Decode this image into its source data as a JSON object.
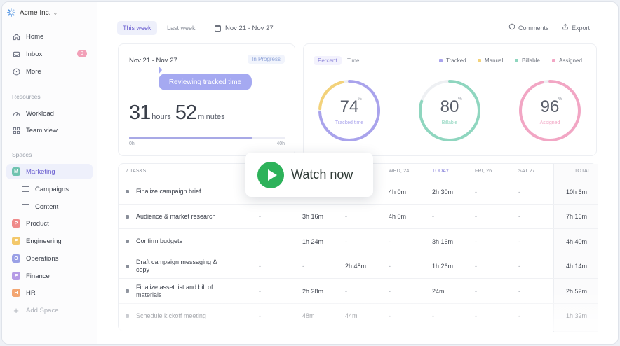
{
  "workspace": {
    "name": "Acme Inc.",
    "caret": "⌄"
  },
  "sidebar": {
    "home": "Home",
    "inbox": "Inbox",
    "inbox_badge": "9",
    "more": "More",
    "resources_title": "Resources",
    "workload": "Workload",
    "team_view": "Team view",
    "spaces_title": "Spaces",
    "spaces": [
      {
        "letter": "M",
        "label": "Marketing",
        "color": "#6fc3b0"
      },
      {
        "letter": "P",
        "label": "Product",
        "color": "#ef8a8a"
      },
      {
        "letter": "E",
        "label": "Engineering",
        "color": "#f3c86b"
      },
      {
        "letter": "O",
        "label": "Operations",
        "color": "#9aa0e6"
      },
      {
        "letter": "F",
        "label": "Finance",
        "color": "#b59be6"
      },
      {
        "letter": "H",
        "label": "HR",
        "color": "#f3a672"
      }
    ],
    "subfolders": [
      "Campaigns",
      "Content"
    ],
    "add_space": "Add Space"
  },
  "topbar": {
    "tab_this_week": "This week",
    "tab_last_week": "Last week",
    "date_range": "Nov 21 - Nov 27",
    "comments": "Comments",
    "export": "Export"
  },
  "summary": {
    "date": "Nov 21 - Nov 27",
    "status": "In Progress",
    "tooltip": "Reviewing tracked time",
    "hours": "31",
    "hours_unit": "hours",
    "minutes": "52",
    "minutes_unit": "minutes",
    "progress": 0.79,
    "min_label": "0h",
    "max_label": "40h"
  },
  "stats": {
    "seg_percent": "Percent",
    "seg_time": "Time",
    "legend": [
      {
        "label": "Tracked",
        "color": "#a9a3ec"
      },
      {
        "label": "Manual",
        "color": "#f3d27a"
      },
      {
        "label": "Billable",
        "color": "#8fd6bf"
      },
      {
        "label": "Assigned",
        "color": "#f2a6c4"
      }
    ],
    "rings": [
      {
        "value": "74",
        "pct": "%",
        "label": "Tracked time",
        "color": "#a9a3ec",
        "frac": 0.74,
        "extra": "#f3d27a",
        "extra_frac": 0.2
      },
      {
        "value": "80",
        "pct": "%",
        "label": "Billable",
        "color": "#8fd6bf",
        "frac": 0.8
      },
      {
        "value": "96",
        "pct": "%",
        "label": "Assigned",
        "color": "#f2a6c4",
        "frac": 0.96
      }
    ]
  },
  "table": {
    "headers": [
      "7 TASKS",
      "",
      "",
      "",
      "WED, 24",
      "TODAY",
      "FRI, 26",
      "SAT 27",
      "TOTAL"
    ],
    "rows": [
      {
        "task": "Finalize campaign brief",
        "cells": [
          "",
          "",
          "",
          "4h 0m",
          "2h 30m",
          "-",
          "-"
        ],
        "total": "10h 6m"
      },
      {
        "task": "Audience & market research",
        "cells": [
          "-",
          "3h 16m",
          "-",
          "4h 0m",
          "-",
          "-",
          "-"
        ],
        "total": "7h 16m"
      },
      {
        "task": "Confirm budgets",
        "cells": [
          "-",
          "1h 24m",
          "-",
          "-",
          "3h 16m",
          "-",
          "-"
        ],
        "total": "4h 40m"
      },
      {
        "task": "Draft campaign messaging & copy",
        "cells": [
          "-",
          "-",
          "2h 48m",
          "-",
          "1h 26m",
          "-",
          "-"
        ],
        "total": "4h 14m"
      },
      {
        "task": "Finalize asset list and bill of materials",
        "cells": [
          "-",
          "2h 28m",
          "-",
          "-",
          "24m",
          "-",
          "-"
        ],
        "total": "2h 52m"
      },
      {
        "task": "Schedule kickoff meeting",
        "cells": [
          "-",
          "48m",
          "44m",
          "-",
          "-",
          "-",
          "-"
        ],
        "total": "1h 32m"
      }
    ]
  },
  "cta": {
    "label": "Watch now"
  }
}
